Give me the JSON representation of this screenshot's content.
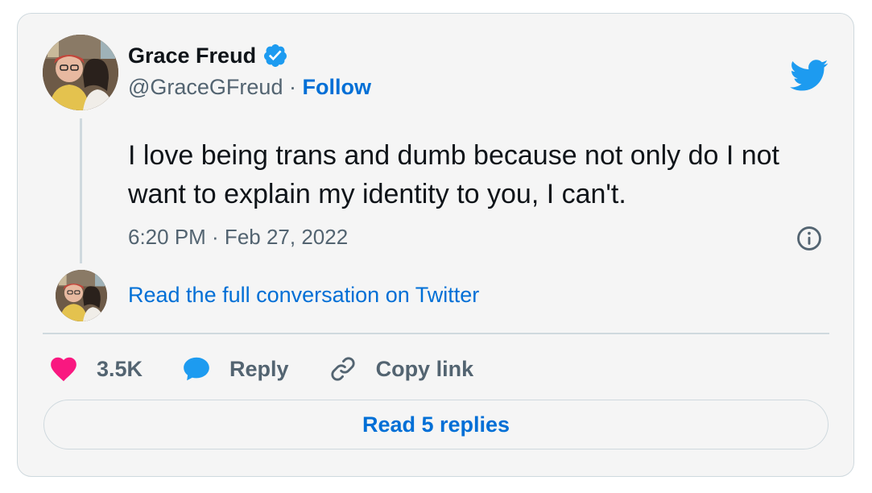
{
  "author": {
    "display_name": "Grace Freud",
    "handle": "@GraceGFreud",
    "separator": "·",
    "follow_label": "Follow"
  },
  "tweet": {
    "text": "I love being trans and dumb because not only do I not want to explain my identity to you, I can't.",
    "timestamp": "6:20 PM · Feb 27, 2022"
  },
  "thread": {
    "read_conversation_label": "Read the full conversation on Twitter"
  },
  "actions": {
    "like_count": "3.5K",
    "reply_label": "Reply",
    "copy_link_label": "Copy link"
  },
  "footer": {
    "read_replies_label": "Read 5 replies"
  },
  "colors": {
    "accent": "#006fd6",
    "twitter_blue": "#1d9bf0",
    "like_pink": "#f91880",
    "text": "#0f1419",
    "muted": "#536471",
    "border": "#cfd9de",
    "card_bg": "#f5f5f5"
  },
  "icons": [
    "verified-badge-icon",
    "twitter-bird-icon",
    "info-icon",
    "heart-icon",
    "reply-bubble-icon",
    "link-icon"
  ]
}
